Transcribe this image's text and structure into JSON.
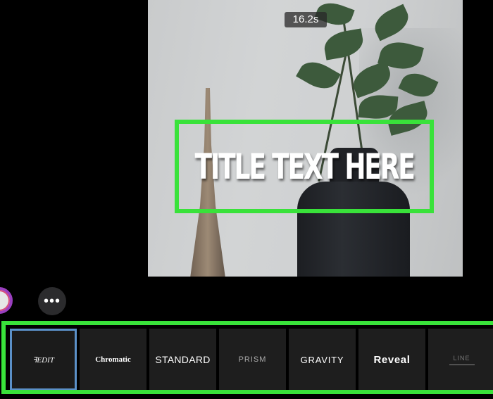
{
  "preview": {
    "duration": "16.2s",
    "title_text": "TITLE TEXT HERE"
  },
  "controls": {
    "more_label": "•••"
  },
  "styles": [
    {
      "label": "ꟻEDIT",
      "selected": true
    },
    {
      "label": "Chromatic",
      "selected": false
    },
    {
      "label": "STANDARD",
      "selected": false
    },
    {
      "label": "PRISM",
      "selected": false
    },
    {
      "label": "GRAVITY",
      "selected": false
    },
    {
      "label": "Reveal",
      "selected": false
    },
    {
      "label": "LINE",
      "selected": false
    }
  ],
  "colors": {
    "highlight": "#39e23a",
    "selection": "#5b90c8",
    "tile_bg": "#1e1e1e"
  }
}
